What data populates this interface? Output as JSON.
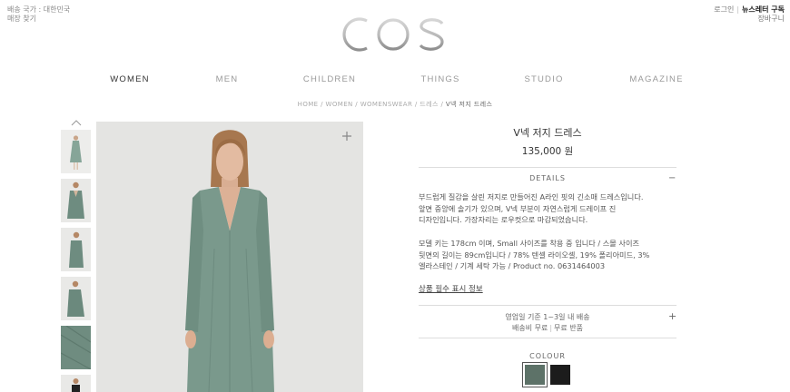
{
  "header": {
    "shipping_country": "배송 국가 : 대한민국",
    "store_finder": "매장 찾기",
    "login": "로그인",
    "newsletter": "뉴스레터 구독",
    "cart": "장바구니",
    "logo_text": "COS"
  },
  "nav": {
    "items": [
      "WOMEN",
      "MEN",
      "CHILDREN",
      "THINGS",
      "STUDIO",
      "MAGAZINE"
    ],
    "active": "WOMEN"
  },
  "breadcrumb": {
    "items": [
      "HOME",
      "WOMEN",
      "WOMENSWEAR",
      "드레스",
      "V넥 저지 드레스"
    ],
    "separator": " / "
  },
  "product": {
    "name": "V넥 저지 드레스",
    "price": "135,000 원",
    "details_heading": "DETAILS",
    "description_lines": [
      "부드럽게 질감을 살린 저지로 만들어진 A라인 핏의 긴소매 드레스입니다.",
      "앞면 중앙에 솔기가 있으며, V넥 부분이 자연스럽게 드레이프 진",
      "디자인입니다. 가장자리는 로우컷으로 마감되었습니다."
    ],
    "fit_lines": [
      "모델 키는 178cm 이며, Small 사이즈를 착용 중 입니다 / 스몰 사이즈",
      "뒷면의 길이는 89cm입니다 / 78% 텐셀 라이오셀, 19% 폴리아미드, 3%",
      "엘라스테인 / 기계 세탁 가능 / Product no. 0631464003"
    ],
    "label_info_link": "상품 필수 표시 정보",
    "shipping_line1": "영업일 기준 1~3일 내 배송",
    "shipping_free": "배송비 무료",
    "returns_free": "무료 반품",
    "colour_heading": "COLOUR",
    "colours": [
      "#5d7268",
      "#1c1c1c"
    ],
    "selected_colour": "#5d7268"
  },
  "colors": {
    "dress": "#7a998c",
    "dress_dark": "#6a877b",
    "background": "#e4e4e2"
  },
  "icons": {
    "thumbnail_up": "chevron-up-icon",
    "zoom": "plus-icon",
    "details_toggle": "minus-icon",
    "shipping_toggle": "plus-icon"
  }
}
